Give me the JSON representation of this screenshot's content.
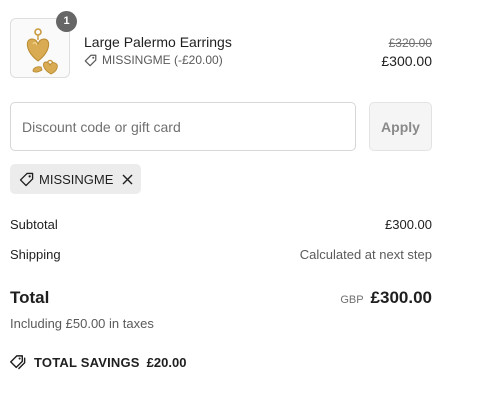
{
  "line_item": {
    "quantity": "1",
    "name": "Large Palermo Earrings",
    "discount_label": "MISSINGME (-£20.00)",
    "original_price": "£320.00",
    "final_price": "£300.00",
    "image": "gold-heart-earrings",
    "discount_icon": "tag-icon"
  },
  "discount_form": {
    "placeholder": "Discount code or gift card",
    "value": "",
    "apply_label": "Apply"
  },
  "applied_code": {
    "code": "MISSINGME",
    "icon": "tag-icon",
    "remove_icon": "close-icon"
  },
  "summary": {
    "subtotal_label": "Subtotal",
    "subtotal_value": "£300.00",
    "shipping_label": "Shipping",
    "shipping_value": "Calculated at next step",
    "total_label": "Total",
    "currency_code": "GBP",
    "total_value": "£300.00",
    "tax_note": "Including £50.00 in taxes"
  },
  "savings": {
    "label": "TOTAL SAVINGS",
    "amount": "£20.00",
    "icon": "tags-icon"
  },
  "colors": {
    "badge": "#666666",
    "chip_background": "#ececec",
    "apply_button_background": "#f5f5f5",
    "apply_button_text": "#8a8a8a",
    "border": "#d6d6d6",
    "text": "#1f1f1f",
    "muted_text": "#5a5a5a",
    "gold": "#d4a54a"
  }
}
